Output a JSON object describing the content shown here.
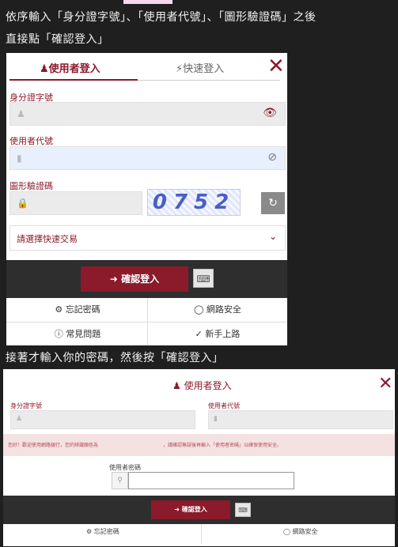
{
  "top_strip_color": "#f5d9ee",
  "caption1_line1": "依序輸入「身分證字號」、「使用者代號」、「圖形驗證碼」之後",
  "caption1_line2": "直接點「確認登入」",
  "panel1": {
    "tab_user_login": "使用者登入",
    "tab_quick_login": "快速登入",
    "close_symbol": "✕",
    "id_label": "身分證字號",
    "user_code_label": "使用者代號",
    "captcha_label": "圖形驗證碼",
    "captcha_text": "0752",
    "quick_trade_placeholder": "請選擇快速交易",
    "confirm_login": "確認登入",
    "forgot_password": "忘記密碼",
    "network_security": "網路安全",
    "faq": "常見問題",
    "new_user_guide": "新手上路"
  },
  "caption2": "接著才輸入你的密碼，然後按「確認登入」",
  "panel2": {
    "title": "使用者登入",
    "close_symbol": "✕",
    "id_label": "身分證字號",
    "user_code_label": "使用者代號",
    "notice_left": "您好！歡迎使用網路銀行，您的辨識顏色為",
    "notice_right": "，請確認無誤後再輸入「使用者密碼」以確保使用安全。",
    "password_label": "使用者密碼",
    "confirm_login": "確認登入",
    "forgot_password": "忘記密碼",
    "network_security": "網路安全"
  },
  "colors": {
    "brand": "#8b1a2b",
    "background": "#1f1f1f"
  }
}
